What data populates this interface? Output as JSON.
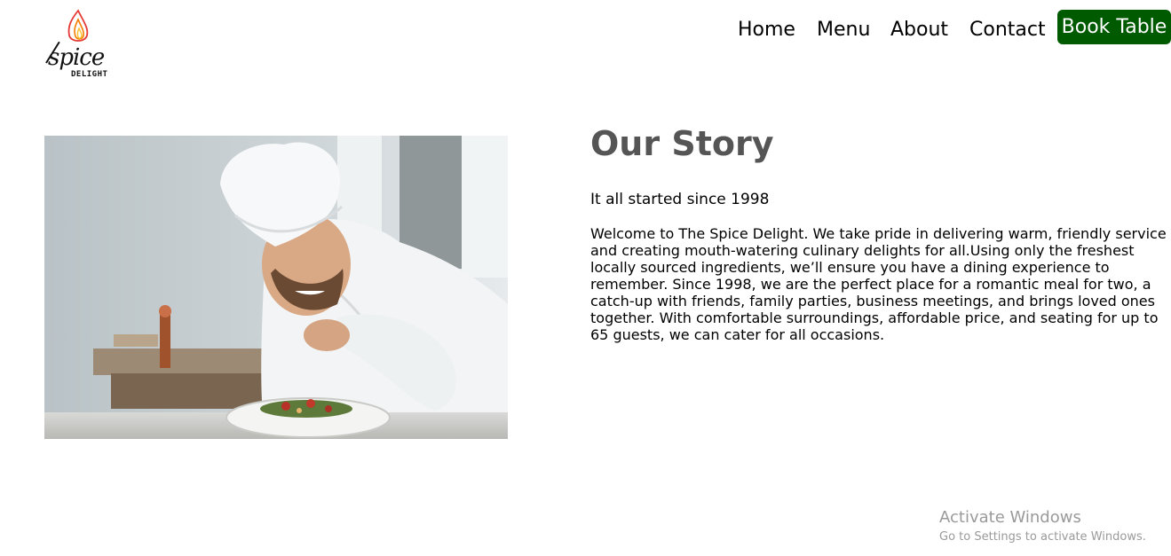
{
  "brand": {
    "logo_text": "spice",
    "logo_subtext": "DELIGHT"
  },
  "nav": {
    "items": [
      {
        "label": "Home"
      },
      {
        "label": "Menu"
      },
      {
        "label": "About"
      },
      {
        "label": "Contact"
      }
    ],
    "cta_label": "Book Table",
    "cta_color": "#005a00"
  },
  "story": {
    "title": "Our Story",
    "subtitle": "It all started since 1998",
    "body_lines": [
      "Welcome to The Spice Delight. We take pride in delivering warm, friendly service",
      "and creating mouth-watering culinary delights for all.Using only the freshest",
      "locally sourced ingredients, we’ll ensure you have a dining experience to",
      "remember. Since 1998, we are the perfect place for a romantic meal for two, a",
      "catch-up with friends, family parties, business meetings, and brings loved ones",
      "together. With comfortable surroundings, affordable price, and seating for up to",
      "65 guests, we can cater for all occasions."
    ],
    "title_color": "#555555"
  },
  "watermark": {
    "title": "Activate Windows",
    "subtitle": "Go to Settings to activate Windows."
  }
}
